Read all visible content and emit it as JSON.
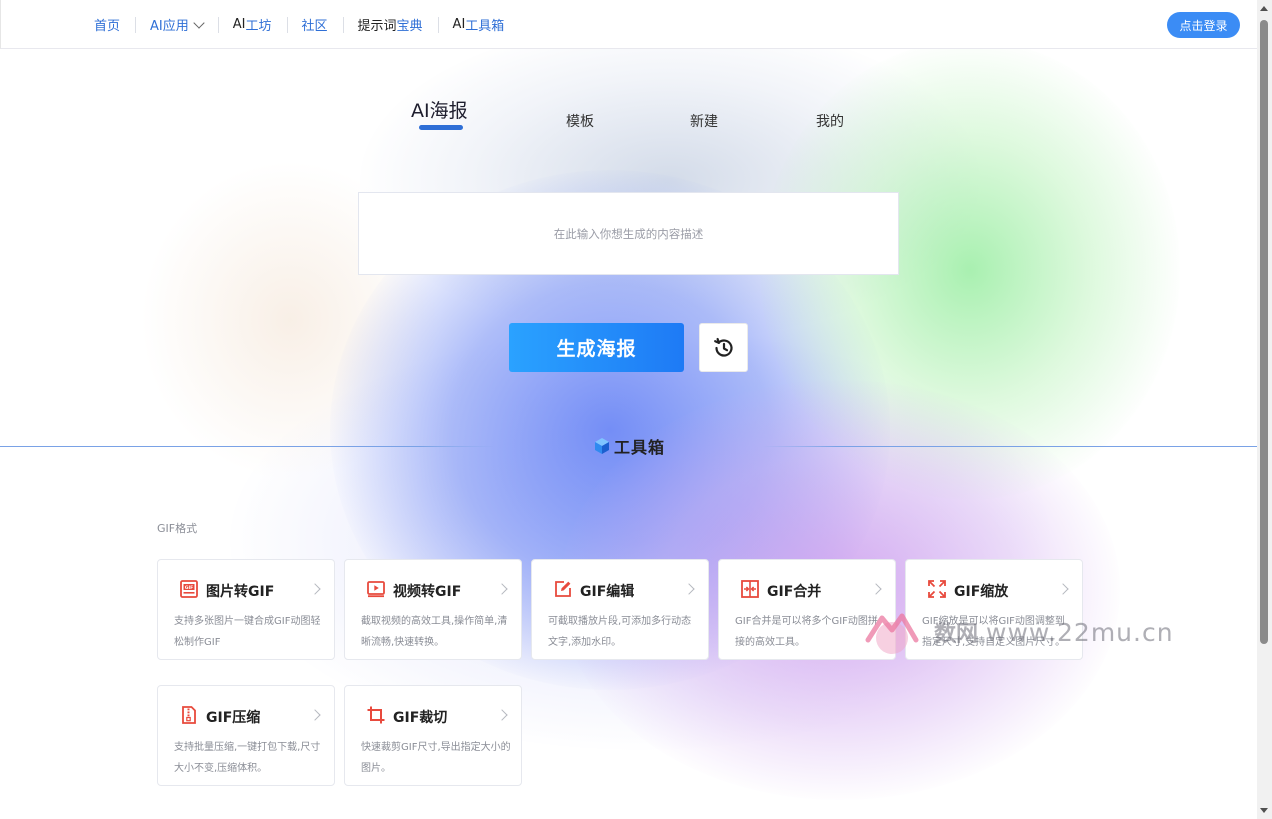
{
  "nav": {
    "items": [
      {
        "label": "首页"
      },
      {
        "label": "AI应用"
      },
      {
        "label_a": "AI",
        "label_b": "工坊"
      },
      {
        "label": "社区"
      },
      {
        "label_a": "提示词",
        "label_b": "宝典"
      },
      {
        "label_a": "AI",
        "label_b": "工具箱"
      }
    ],
    "login_label": "点击登录"
  },
  "tabs": [
    {
      "label": "AI海报",
      "active": true
    },
    {
      "label": "模板"
    },
    {
      "label": "新建"
    },
    {
      "label": "我的"
    }
  ],
  "prompt": {
    "placeholder": "在此输入你想生成的内容描述",
    "value": ""
  },
  "generate_label": "生成海报",
  "history_icon": "history-icon",
  "toolbox_title": "工具箱",
  "category_label": "GIF格式",
  "tools": [
    {
      "title": "图片转GIF",
      "desc": "支持多张图片一键合成GIF动图轻松制作GIF",
      "icon": "gif-image-icon"
    },
    {
      "title": "视频转GIF",
      "desc": "截取视频的高效工具,操作简单,清晰流畅,快速转换。",
      "icon": "video-icon"
    },
    {
      "title": "GIF编辑",
      "desc": "可截取播放片段,可添加多行动态文字,添加水印。",
      "icon": "edit-icon"
    },
    {
      "title": "GIF合并",
      "desc": "GIF合并是可以将多个GIF动图拼接的高效工具。",
      "icon": "merge-icon"
    },
    {
      "title": "GIF缩放",
      "desc": "GIF缩放是可以将GIF动图调整到指定尺寸,支持自定义图片尺寸。",
      "icon": "resize-icon"
    },
    {
      "title": "GIF压缩",
      "desc": "支持批量压缩,一键打包下载,尺寸大小不变,压缩体积。",
      "icon": "compress-icon"
    },
    {
      "title": "GIF裁切",
      "desc": "快速裁剪GIF尺寸,导出指定大小的图片。",
      "icon": "crop-icon"
    }
  ],
  "watermark": {
    "text": "www.22mu.cn"
  },
  "colors": {
    "accent": "#2f6fd6",
    "icon_red": "#e84a3d",
    "login_bg": "#3b8cf5"
  }
}
